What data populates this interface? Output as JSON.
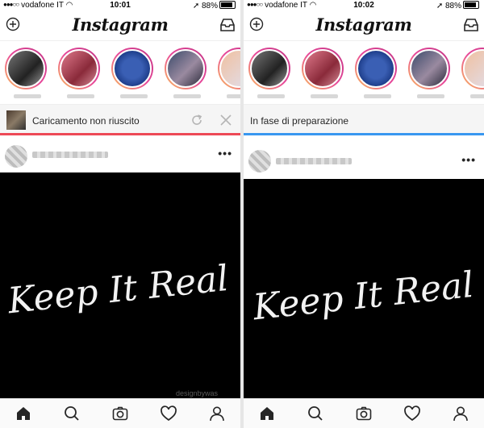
{
  "app": {
    "logo": "Instagram"
  },
  "left": {
    "status": {
      "carrier": "vodafone IT",
      "time": "10:01",
      "battery": "88%",
      "battery_level": 0.88
    },
    "banner": {
      "text": "Caricamento non riuscito",
      "progress": 1.0,
      "progress_color": "#ed4956"
    },
    "post": {
      "image_text": "Keep It Real",
      "watermark": "designbywas"
    }
  },
  "right": {
    "status": {
      "carrier": "vodafone IT",
      "time": "10:02",
      "battery": "88%",
      "battery_level": 0.88
    },
    "banner": {
      "text": "In fase di preparazione",
      "progress": 1.0,
      "progress_color": "#3897f0"
    },
    "post": {
      "image_text": "Keep It Real"
    }
  },
  "icons": {
    "header": [
      "plus-icon",
      "inbox-icon"
    ],
    "banner_actions": [
      "retry-icon",
      "close-icon"
    ],
    "post": [
      "more-icon"
    ],
    "tabbar": [
      "home-icon",
      "search-icon",
      "camera-icon",
      "heart-icon",
      "profile-icon"
    ]
  },
  "colors": {
    "failed": "#ed4956",
    "processing": "#3897f0",
    "image_bg": "#000000"
  }
}
